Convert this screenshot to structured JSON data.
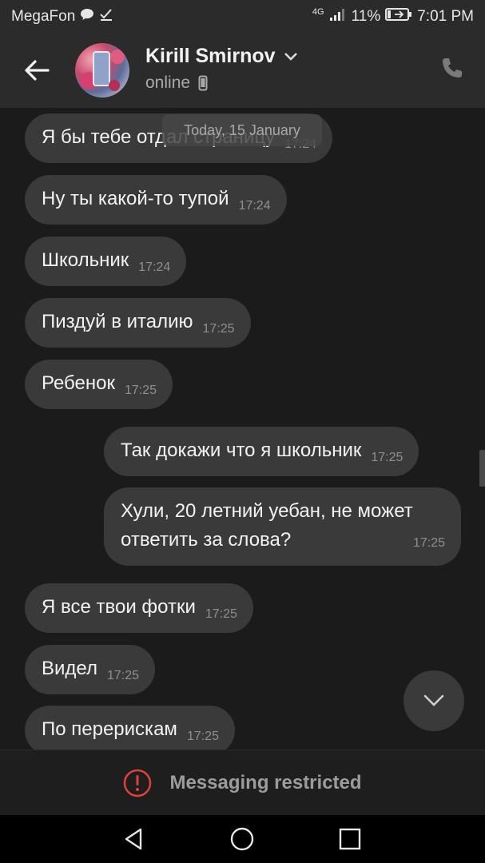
{
  "status_bar": {
    "carrier": "MegaFon",
    "network": "4G",
    "battery": "11%",
    "time": "7:01 PM"
  },
  "header": {
    "contact_name": "Kirill Smirnov",
    "contact_status": "online"
  },
  "date_chip": "Today, 15 January",
  "messages": [
    {
      "direction": "in",
      "text": "Я бы тебе отдал страницу",
      "time": "17:24"
    },
    {
      "direction": "in",
      "text": "Ну ты какой-то тупой",
      "time": "17:24"
    },
    {
      "direction": "in",
      "text": "Школьник",
      "time": "17:24"
    },
    {
      "direction": "in",
      "text": "Пиздуй в италию",
      "time": "17:25"
    },
    {
      "direction": "in",
      "text": "Ребенок",
      "time": "17:25"
    },
    {
      "direction": "out",
      "text": "Так докажи что я школьник",
      "time": "17:25"
    },
    {
      "direction": "out",
      "text_line1": "Хули, 20 летний уебан, не может",
      "text_line2": "ответить за слова?",
      "time": "17:25"
    },
    {
      "direction": "in",
      "text": "Я все твои фотки",
      "time": "17:25"
    },
    {
      "direction": "in",
      "text": "Видел",
      "time": "17:25"
    },
    {
      "direction": "in",
      "text": "По перерискам",
      "time": "17:25"
    }
  ],
  "footer": {
    "restricted_label": "Messaging restricted"
  },
  "colors": {
    "background": "#1b1b1b",
    "bubble": "#3a3a3a",
    "header": "#2b2b2b",
    "warning": "#e0403a"
  }
}
